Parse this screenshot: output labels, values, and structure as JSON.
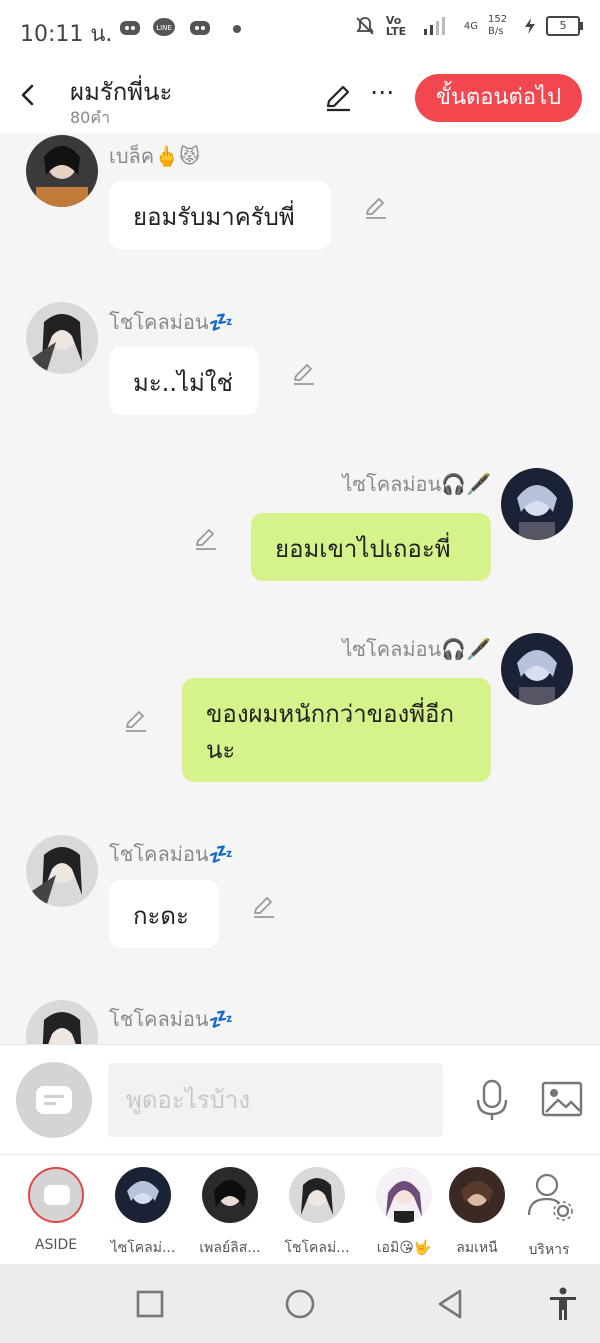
{
  "status_bar": {
    "time": "10:11 น.",
    "network": "Vo LTE",
    "signal": "4G",
    "speed": "152 B/s",
    "battery": "5"
  },
  "header": {
    "title": "ผมรักพี่นะ",
    "word_count": "80คำ",
    "next_button": "ขั้นตอนต่อไป"
  },
  "messages": [
    {
      "side": "left",
      "name": "เบล็ค🖕😾",
      "text": "ยอมรับมาครับพี่"
    },
    {
      "side": "left",
      "name": "โชโคลม่อน💤",
      "text": "มะ..ไม่ใช่"
    },
    {
      "side": "right",
      "name": "ไซโคลม่อน🎧🖋️",
      "text": "ยอมเขาไปเถอะพี่"
    },
    {
      "side": "right",
      "name": "ไซโคลม่อน🎧🖋️",
      "text": "ของผมหนักกว่าของพี่อีกนะ"
    },
    {
      "side": "left",
      "name": "โชโคลม่อน💤",
      "text": "กะดะ"
    },
    {
      "side": "left",
      "name": "โชโคลม่อน💤",
      "text": ""
    }
  ],
  "input": {
    "placeholder": "พูดอะไรบ้าง",
    "value": ""
  },
  "characters": [
    {
      "label": "ASIDE"
    },
    {
      "label": "ไซโคลม่..."
    },
    {
      "label": "เพลย์ลิส..."
    },
    {
      "label": "โชโคลม่..."
    },
    {
      "label": "เอมิ😘🤟"
    },
    {
      "label": "ลมเหนื"
    },
    {
      "label": "บริหาร"
    }
  ],
  "colors": {
    "accent": "#f2474f",
    "bubble_right": "#d5f28b",
    "bubble_left": "#ffffff"
  }
}
